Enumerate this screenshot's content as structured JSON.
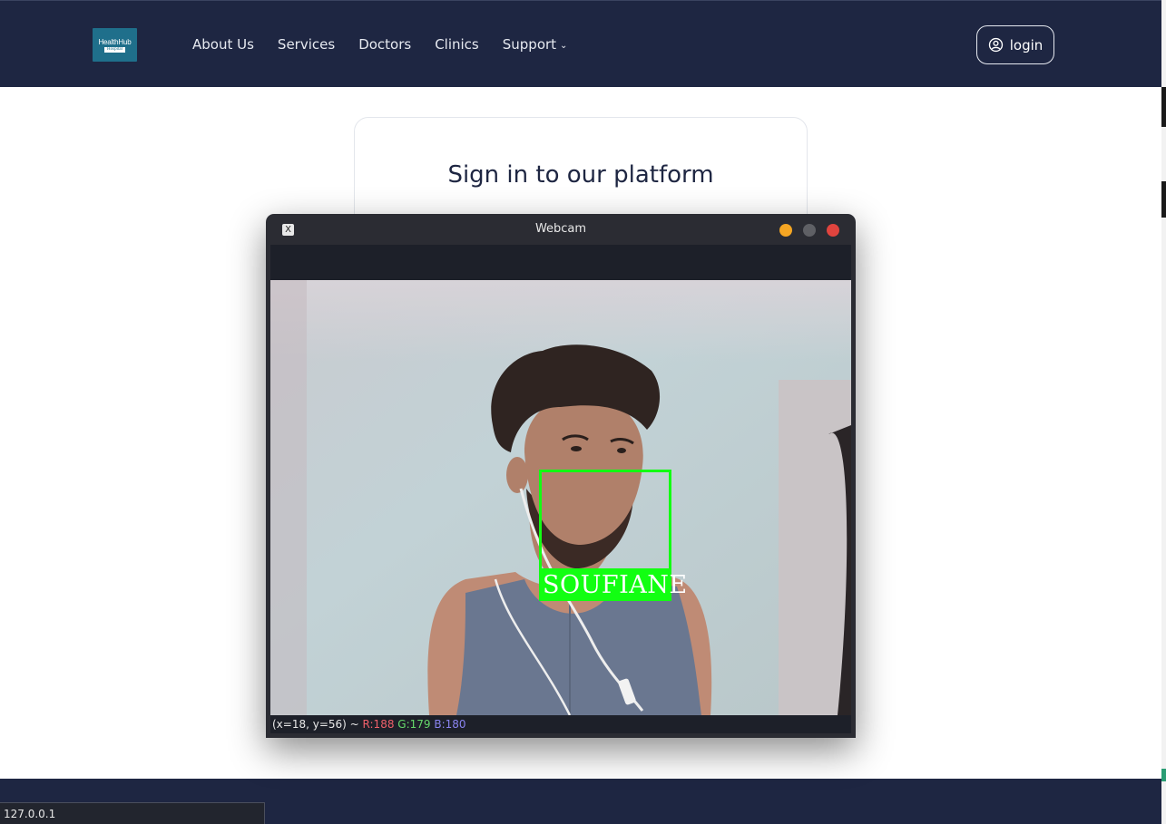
{
  "nav": {
    "logo": {
      "line1": "HealthHub",
      "line2": "Hospital"
    },
    "links": [
      {
        "label": "About Us"
      },
      {
        "label": "Services"
      },
      {
        "label": "Doctors"
      },
      {
        "label": "Clinics"
      },
      {
        "label": "Support",
        "icon": "chevron-down-icon"
      }
    ],
    "login_label": "login",
    "login_icon": "user-circle-icon"
  },
  "card": {
    "title": "Sign in to our platform"
  },
  "webcam": {
    "window_title": "Webcam",
    "app_icon": "x11-icon",
    "detection": {
      "name": "SOUFIANE",
      "box_color": "#12ff12"
    },
    "status": {
      "coords": "(x=18, y=56) ~",
      "r": "R:188",
      "g": "G:179",
      "b": "B:180"
    }
  },
  "status_url": "127.0.0.1",
  "colors": {
    "nav_bg": "#1e2642",
    "accent_green": "#12ff12",
    "close_red": "#e0443e",
    "minimize_yellow": "#f5a623"
  }
}
